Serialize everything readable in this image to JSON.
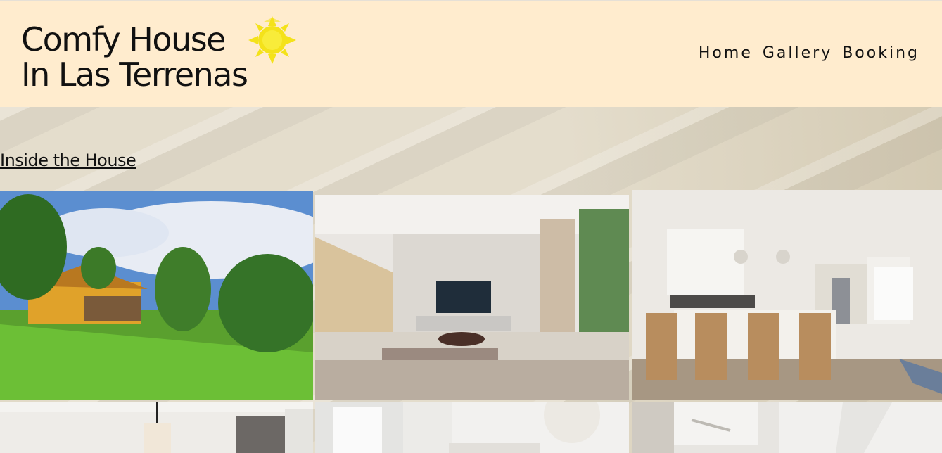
{
  "header": {
    "logo_line1": "Comfy House",
    "logo_line2": "In Las Terrenas",
    "nav": [
      "Home",
      "Gallery",
      "Booking"
    ]
  },
  "section": {
    "title": "Inside the House"
  },
  "colors": {
    "header_bg": "#ffecce",
    "sun": "#f4e21a",
    "sand": "#ddd4be"
  },
  "gallery": {
    "images": [
      "house-exterior-photo",
      "living-room-photo",
      "kitchen-photo",
      "bedroom-photo",
      "bedroom-2-photo",
      "bathroom-photo"
    ]
  }
}
